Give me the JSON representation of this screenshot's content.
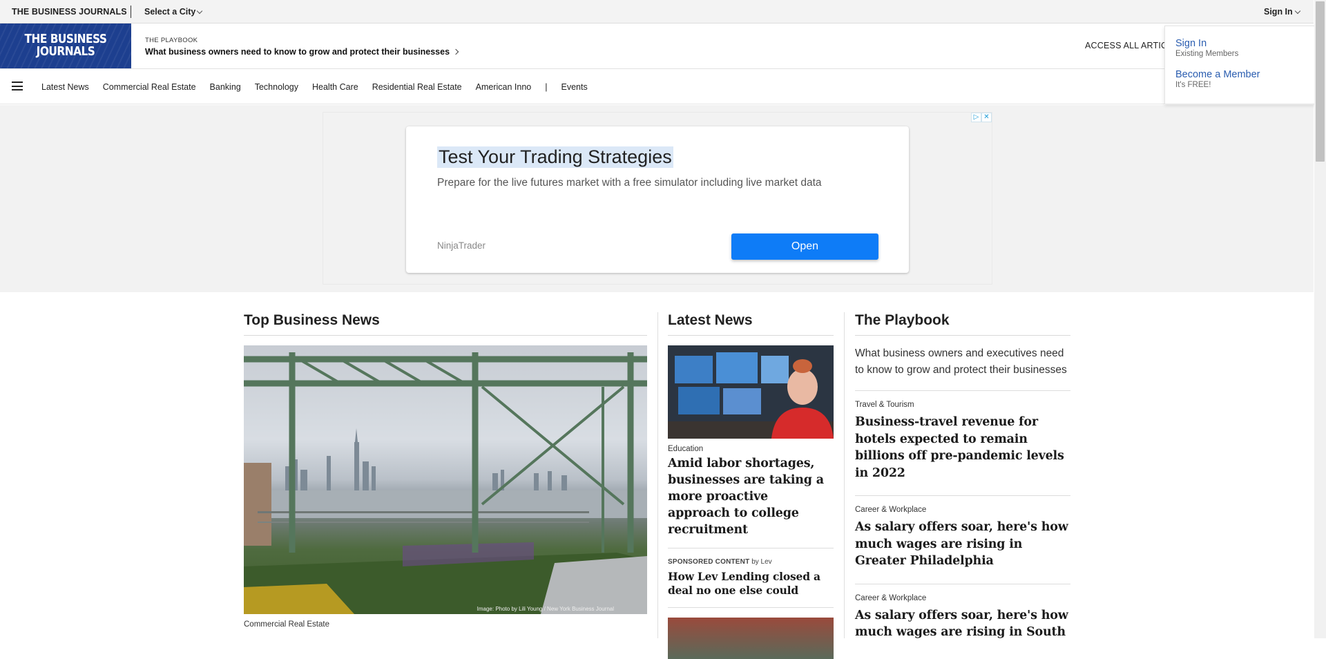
{
  "topbar": {
    "brand": "THE BUSINESS JOURNALS",
    "city_selector": "Select a City",
    "sign_in": "Sign In"
  },
  "header": {
    "logo_line1": "THE BUSINESS",
    "logo_line2": "JOURNALS",
    "playbook_eyebrow": "THE PLAYBOOK",
    "playbook_link": "What business owners need to know to grow and protect their businesses",
    "access_all": "ACCESS ALL ARTICL"
  },
  "nav": {
    "items": [
      "Latest News",
      "Commercial Real Estate",
      "Banking",
      "Technology",
      "Health Care",
      "Residential Real Estate",
      "American Inno"
    ],
    "divider": "|",
    "events": "Events"
  },
  "signin_dropdown": {
    "sign_in": "Sign In",
    "sign_in_sub": "Existing Members",
    "become": "Become a Member",
    "become_sub": "It's FREE!"
  },
  "ad": {
    "title": "Test Your Trading Strategies",
    "description": "Prepare for the live futures market with a free simulator including live market data",
    "advertiser": "NinjaTrader",
    "cta": "Open",
    "choices_icon": "▷",
    "close_icon": "✕"
  },
  "top_business_news": {
    "heading": "Top Business News",
    "image_credit": "Image: Photo by Lili Young / New York Business Journal",
    "category": "Commercial Real Estate"
  },
  "latest_news": {
    "heading": "Latest News",
    "story1": {
      "category": "Education",
      "headline": "Amid labor shortages, businesses are taking a more proactive approach to college recruitment"
    },
    "sponsored": {
      "label": "SPONSORED CONTENT",
      "by": "by Lev",
      "headline": "How Lev Lending closed a deal no one else could"
    }
  },
  "playbook": {
    "heading": "The Playbook",
    "description": "What business owners and executives need to know to grow and protect their businesses",
    "stories": [
      {
        "category": "Travel & Tourism",
        "headline": "Business-travel revenue for hotels expected to remain billions off pre-pandemic levels in 2022"
      },
      {
        "category": "Career & Workplace",
        "headline": "As salary offers soar, here's how much wages are rising in Greater Philadelphia"
      },
      {
        "category": "Career & Workplace",
        "headline": "As salary offers soar, here's how much wages are rising in South"
      }
    ]
  }
}
